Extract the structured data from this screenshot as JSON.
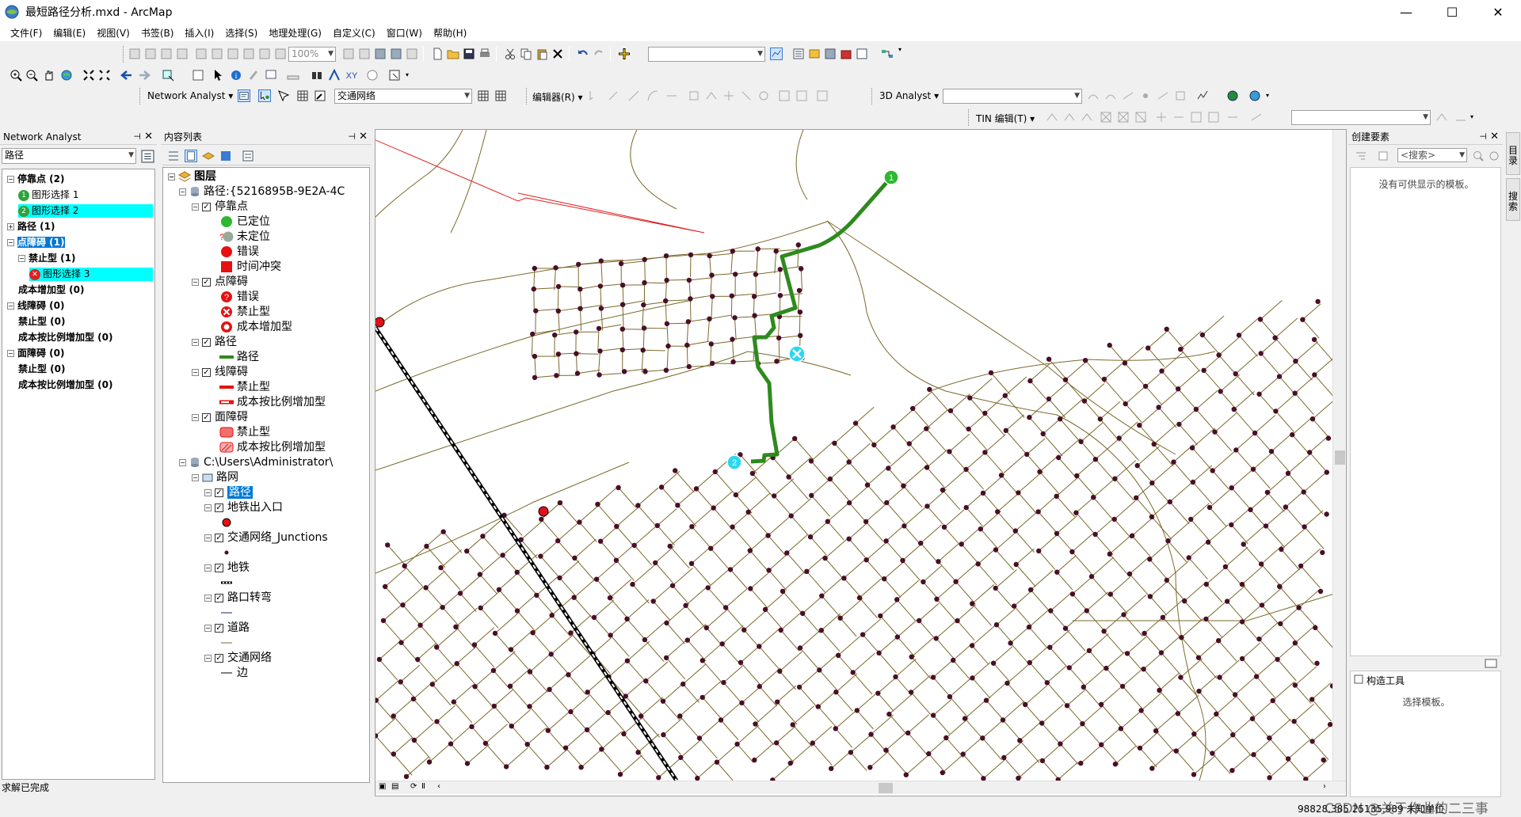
{
  "window": {
    "title": "最短路径分析.mxd - ArcMap",
    "minimize": "—",
    "maximize": "☐",
    "close": "✕"
  },
  "menu": [
    "文件(F)",
    "编辑(E)",
    "视图(V)",
    "书签(B)",
    "插入(I)",
    "选择(S)",
    "地理处理(G)",
    "自定义(C)",
    "窗口(W)",
    "帮助(H)"
  ],
  "toolbar": {
    "zoom_value": "100%",
    "network_analyst_label": "Network Analyst ▾",
    "network_dataset": "交通网络",
    "editor_label": "编辑器(R) ▾",
    "analyst3d_label": "3D Analyst ▾",
    "tin_label": "TIN 编辑(T) ▾"
  },
  "na_window": {
    "title": "Network Analyst",
    "layer_select": "路径",
    "items": [
      {
        "label": "停靠点 (2)",
        "level": 0,
        "bold": true,
        "expanded": true
      },
      {
        "label": "图形选择 1",
        "level": 1,
        "badge": "1",
        "badge_color": "#2ea43a",
        "highlight": false
      },
      {
        "label": "图形选择 2",
        "level": 1,
        "badge": "2",
        "badge_color": "#2ea43a",
        "highlight": true
      },
      {
        "label": "路径 (1)",
        "level": 0,
        "bold": true,
        "expanded": false
      },
      {
        "label": "点障碍 (1)",
        "level": 0,
        "bold": true,
        "expanded": true,
        "selected": true
      },
      {
        "label": "禁止型 (1)",
        "level": 1,
        "bold": true,
        "expanded": true
      },
      {
        "label": "图形选择 3",
        "level": 2,
        "badge": "x",
        "badge_color": "#e02020",
        "highlight": true
      },
      {
        "label": "成本增加型 (0)",
        "level": 1,
        "bold": true
      },
      {
        "label": "线障碍 (0)",
        "level": 0,
        "bold": true,
        "expanded": true
      },
      {
        "label": "禁止型 (0)",
        "level": 1,
        "bold": true
      },
      {
        "label": "成本按比例增加型 (0)",
        "level": 1,
        "bold": true
      },
      {
        "label": "面障碍 (0)",
        "level": 0,
        "bold": true,
        "expanded": true
      },
      {
        "label": "禁止型 (0)",
        "level": 1,
        "bold": true
      },
      {
        "label": "成本按比例增加型 (0)",
        "level": 1,
        "bold": true
      }
    ],
    "status": "求解已完成"
  },
  "toc": {
    "title": "内容列表",
    "root": "图层",
    "items": [
      {
        "label": "路径:{5216895B-9E2A-4C",
        "type": "group"
      },
      {
        "label": "停靠点",
        "type": "layer"
      },
      {
        "label": "已定位",
        "type": "legend",
        "sym": "dot-green"
      },
      {
        "label": "未定位",
        "type": "legend",
        "sym": "dot-gray"
      },
      {
        "label": "错误",
        "type": "legend",
        "sym": "dot-red"
      },
      {
        "label": "时间冲突",
        "type": "legend",
        "sym": "sq-red"
      },
      {
        "label": "点障碍",
        "type": "layer"
      },
      {
        "label": "错误",
        "type": "legend",
        "sym": "q-red"
      },
      {
        "label": "禁止型",
        "type": "legend",
        "sym": "x-red"
      },
      {
        "label": "成本增加型",
        "type": "legend",
        "sym": "ring-red"
      },
      {
        "label": "路径",
        "type": "layer"
      },
      {
        "label": "路径",
        "type": "legend",
        "sym": "line-green"
      },
      {
        "label": "线障碍",
        "type": "layer"
      },
      {
        "label": "禁止型",
        "type": "legend",
        "sym": "line-red"
      },
      {
        "label": "成本按比例增加型",
        "type": "legend",
        "sym": "line-redw"
      },
      {
        "label": "面障碍",
        "type": "layer"
      },
      {
        "label": "禁止型",
        "type": "legend",
        "sym": "poly-red"
      },
      {
        "label": "成本按比例增加型",
        "type": "legend",
        "sym": "poly-redh"
      },
      {
        "label": "C:\\Users\\Administrator\\",
        "type": "group"
      },
      {
        "label": "路网",
        "type": "group2"
      },
      {
        "label": "路径",
        "type": "layer2",
        "selected": true
      },
      {
        "label": "地铁出入口",
        "type": "layer2"
      },
      {
        "label": "",
        "type": "legend2",
        "sym": "dot-red-small"
      },
      {
        "label": "交通网络_Junctions",
        "type": "layer2"
      },
      {
        "label": "",
        "type": "legend2",
        "sym": "dot-dark"
      },
      {
        "label": "地铁",
        "type": "layer2"
      },
      {
        "label": "",
        "type": "legend2",
        "sym": "rail"
      },
      {
        "label": "路口转弯",
        "type": "layer2"
      },
      {
        "label": "",
        "type": "legend2",
        "sym": "line-navy"
      },
      {
        "label": "道路",
        "type": "layer2"
      },
      {
        "label": "",
        "type": "legend2",
        "sym": "line-olive"
      },
      {
        "label": "交通网络",
        "type": "layer2"
      },
      {
        "label": "边",
        "type": "legend2",
        "sym": "line-black"
      }
    ]
  },
  "map": {
    "stop_labels": [
      "1",
      "2"
    ],
    "colors": {
      "road": "#7a6a2a",
      "junction": "#4a0e26",
      "route": "#2e8a1e",
      "stop": "#2db82d",
      "barrier": "#29d8f0",
      "subway_entrance": "#e0101a"
    }
  },
  "create_features": {
    "title": "创建要素",
    "search_placeholder": "<搜索>",
    "empty_msg": "没有可供显示的模板。",
    "construct_title": "构造工具",
    "construct_msg": "选择模板。"
  },
  "side_tabs": [
    "目录",
    "搜索"
  ],
  "status": {
    "coords": "98828.385  25135.989 未知单位",
    "watermark": "CSDN @关于作业的二三事"
  }
}
